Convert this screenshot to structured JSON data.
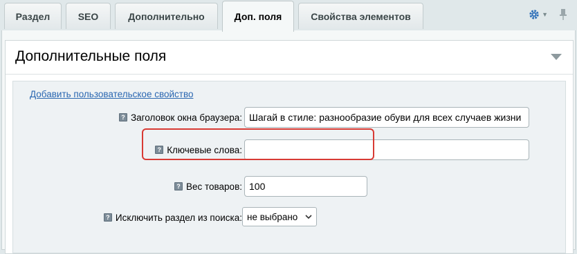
{
  "tabs": [
    {
      "label": "Раздел",
      "active": false
    },
    {
      "label": "SEO",
      "active": false
    },
    {
      "label": "Дополнительно",
      "active": false
    },
    {
      "label": "Доп. поля",
      "active": true
    },
    {
      "label": "Свойства элементов",
      "active": false
    }
  ],
  "tools": {
    "settings_icon": "gear-icon",
    "pin_icon": "pin-icon"
  },
  "section": {
    "title": "Дополнительные поля",
    "add_link": "Добавить пользовательское свойство",
    "fields": {
      "browser_title": {
        "label": "Заголовок окна браузера:",
        "value": "Шагай в стиле: разнообразие обуви для всех случаев жизни"
      },
      "keywords": {
        "label": "Ключевые слова:",
        "value": ""
      },
      "weight": {
        "label": "Вес товаров:",
        "value": "100"
      },
      "exclude_search": {
        "label": "Исключить раздел из поиска:",
        "selected": "не выбрано"
      }
    }
  },
  "colors": {
    "accent": "#2a67b1",
    "highlight": "#d83a34"
  }
}
